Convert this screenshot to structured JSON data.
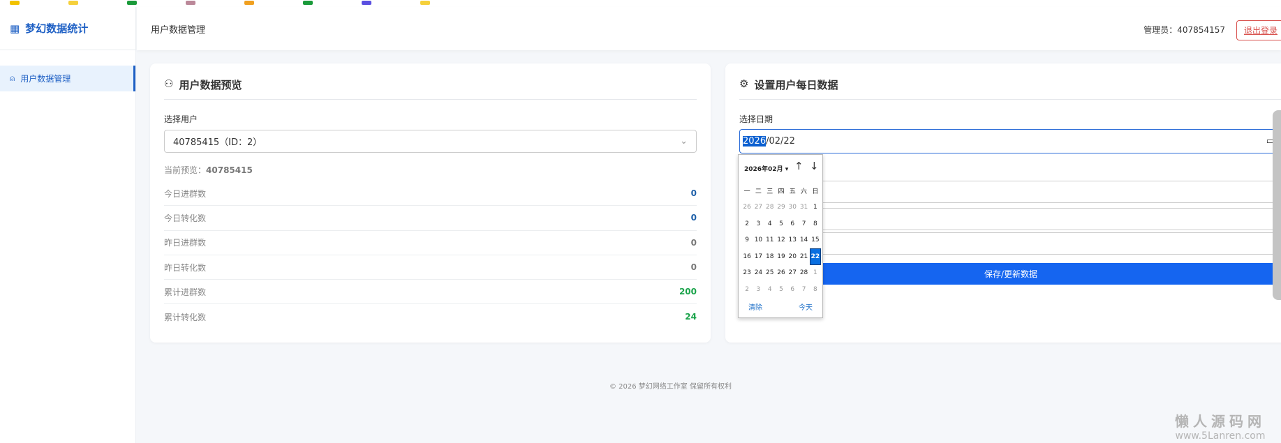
{
  "sidebar": {
    "brand": "梦幻数据统计",
    "items": [
      {
        "label": "用户数据管理"
      }
    ]
  },
  "header": {
    "title": "用户数据管理",
    "admin": "管理员：407854157",
    "logout": "退出登录"
  },
  "preview_card": {
    "title": "用户数据预览",
    "select_label": "选择用户",
    "selected_user": "40785415（ID：2）",
    "current_label": "当前预览：",
    "current_value": "40785415",
    "rows": [
      {
        "label": "今日进群数",
        "value": "0",
        "color": "#1d5fa8"
      },
      {
        "label": "今日转化数",
        "value": "0",
        "color": "#1d5fa8"
      },
      {
        "label": "昨日进群数",
        "value": "0",
        "color": "#777777"
      },
      {
        "label": "昨日转化数",
        "value": "0",
        "color": "#777777"
      },
      {
        "label": "累计进群数",
        "value": "200",
        "color": "#1aa34a"
      },
      {
        "label": "累计转化数",
        "value": "24",
        "color": "#1aa34a"
      }
    ]
  },
  "settings_card": {
    "title": "设置用户每日数据",
    "date_label": "选择日期",
    "date_year": "2026",
    "date_rest": "/02/22",
    "save": "保存/更新数据"
  },
  "calendar": {
    "month": "2026年02月 ▾",
    "weekdays": [
      "一",
      "二",
      "三",
      "四",
      "五",
      "六",
      "日"
    ],
    "days": [
      "26",
      "27",
      "28",
      "29",
      "30",
      "31",
      "1",
      "2",
      "3",
      "4",
      "5",
      "6",
      "7",
      "8",
      "9",
      "10",
      "11",
      "12",
      "13",
      "14",
      "15",
      "16",
      "17",
      "18",
      "19",
      "20",
      "21",
      "22",
      "23",
      "24",
      "25",
      "26",
      "27",
      "28",
      "1",
      "2",
      "3",
      "4",
      "5",
      "6",
      "7",
      "8"
    ],
    "selected": "22",
    "clear": "清除",
    "today": "今天"
  },
  "footer": "© 2026 梦幻网络工作室 保留所有权利",
  "watermark": {
    "title": "懒人源码网",
    "url": "www.5Lanren.com"
  }
}
